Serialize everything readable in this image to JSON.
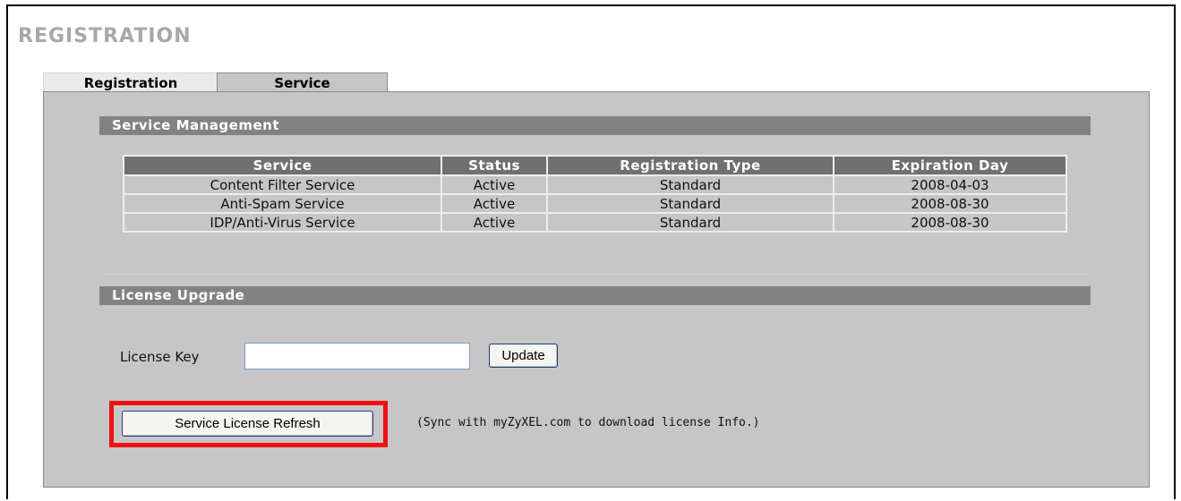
{
  "page": {
    "title": "REGISTRATION"
  },
  "tabs": [
    {
      "label": "Registration",
      "active": false
    },
    {
      "label": "Service",
      "active": true
    }
  ],
  "service_management": {
    "heading": "Service Management",
    "columns": [
      "Service",
      "Status",
      "Registration Type",
      "Expiration Day"
    ],
    "rows": [
      [
        "Content Filter Service",
        "Active",
        "Standard",
        "2008-04-03"
      ],
      [
        "Anti-Spam Service",
        "Active",
        "Standard",
        "2008-08-30"
      ],
      [
        "IDP/Anti-Virus Service",
        "Active",
        "Standard",
        "2008-08-30"
      ]
    ]
  },
  "license_upgrade": {
    "heading": "License Upgrade",
    "key_label": "License Key",
    "key_value": "",
    "update_label": "Update",
    "refresh_label": "Service License Refresh",
    "sync_note": "(Sync with myZyXEL.com to download license Info.)"
  },
  "colors": {
    "section_bar": "#828282",
    "table_header": "#707070",
    "panel": "#c6c6c6",
    "highlight": "#ee1111"
  }
}
